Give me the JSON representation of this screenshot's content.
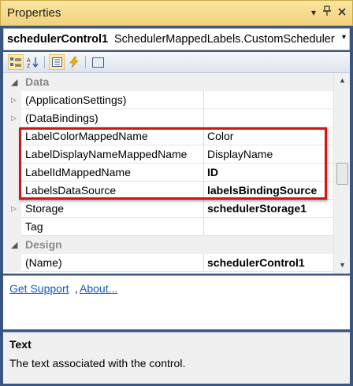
{
  "window": {
    "title": "Properties",
    "buttons": [
      "▾",
      "📌",
      "✕"
    ]
  },
  "object_selector": {
    "name": "schedulerControl1",
    "type": "SchedulerMappedLabels.CustomScheduler",
    "dropdown": "▾"
  },
  "toolbar": {
    "buttons": [
      "categorized-icon",
      "alphabetical-icon",
      "properties-icon",
      "events-icon",
      "property-pages-icon"
    ]
  },
  "grid": {
    "categories": [
      {
        "label": "Data",
        "expanded": true
      },
      {
        "label": "Design",
        "expanded": true
      }
    ],
    "rows": [
      {
        "name": "(ApplicationSettings)",
        "value": "",
        "expandable": true,
        "bold": false
      },
      {
        "name": "(DataBindings)",
        "value": "",
        "expandable": true,
        "bold": false
      },
      {
        "name": "LabelColorMappedName",
        "value": "Color",
        "expandable": false,
        "bold": false
      },
      {
        "name": "LabelDisplayNameMappedName",
        "value": "DisplayName",
        "expandable": false,
        "bold": false
      },
      {
        "name": "LabelIdMappedName",
        "value": "ID",
        "expandable": false,
        "bold": true
      },
      {
        "name": "LabelsDataSource",
        "value": "labelsBindingSource",
        "expandable": false,
        "bold": true
      },
      {
        "name": "Storage",
        "value": "schedulerStorage1",
        "expandable": true,
        "bold": true
      },
      {
        "name": "Tag",
        "value": "",
        "expandable": false,
        "bold": false
      },
      {
        "name": "(Name)",
        "value": "schedulerControl1",
        "expandable": false,
        "bold": true
      }
    ]
  },
  "links": {
    "support": "Get Support",
    "separator": ",",
    "about": "About..."
  },
  "description": {
    "title": "Text",
    "text": "The text associated with the control."
  },
  "colors": {
    "highlight_box": "#d21515",
    "title_bar": "#f2d27a",
    "link": "#1155cc"
  }
}
